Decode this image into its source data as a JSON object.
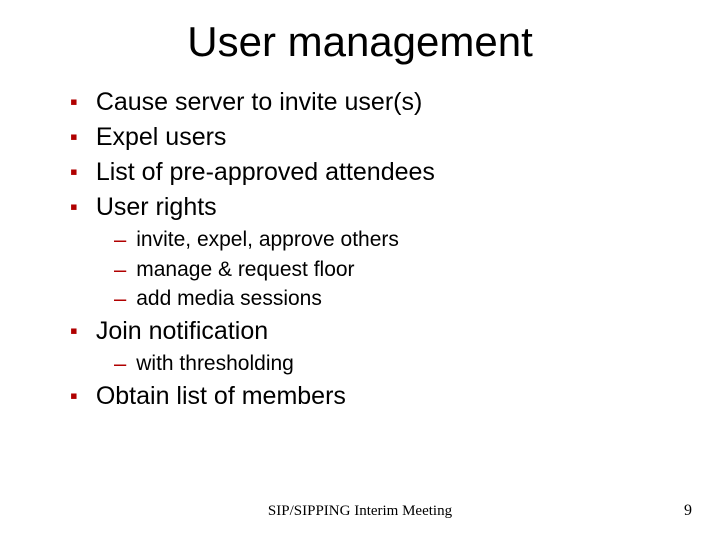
{
  "title": "User management",
  "bullets": {
    "b0": "Cause server to invite user(s)",
    "b1": "Expel users",
    "b2": "List of pre-approved attendees",
    "b3": "User rights",
    "b3_sub": {
      "s0": "invite, expel, approve others",
      "s1": "manage & request floor",
      "s2": "add media sessions"
    },
    "b4": "Join notification",
    "b4_sub": {
      "s0": "with thresholding"
    },
    "b5": "Obtain list of members"
  },
  "footer": {
    "center": "SIP/SIPPING Interim Meeting",
    "page": "9"
  }
}
